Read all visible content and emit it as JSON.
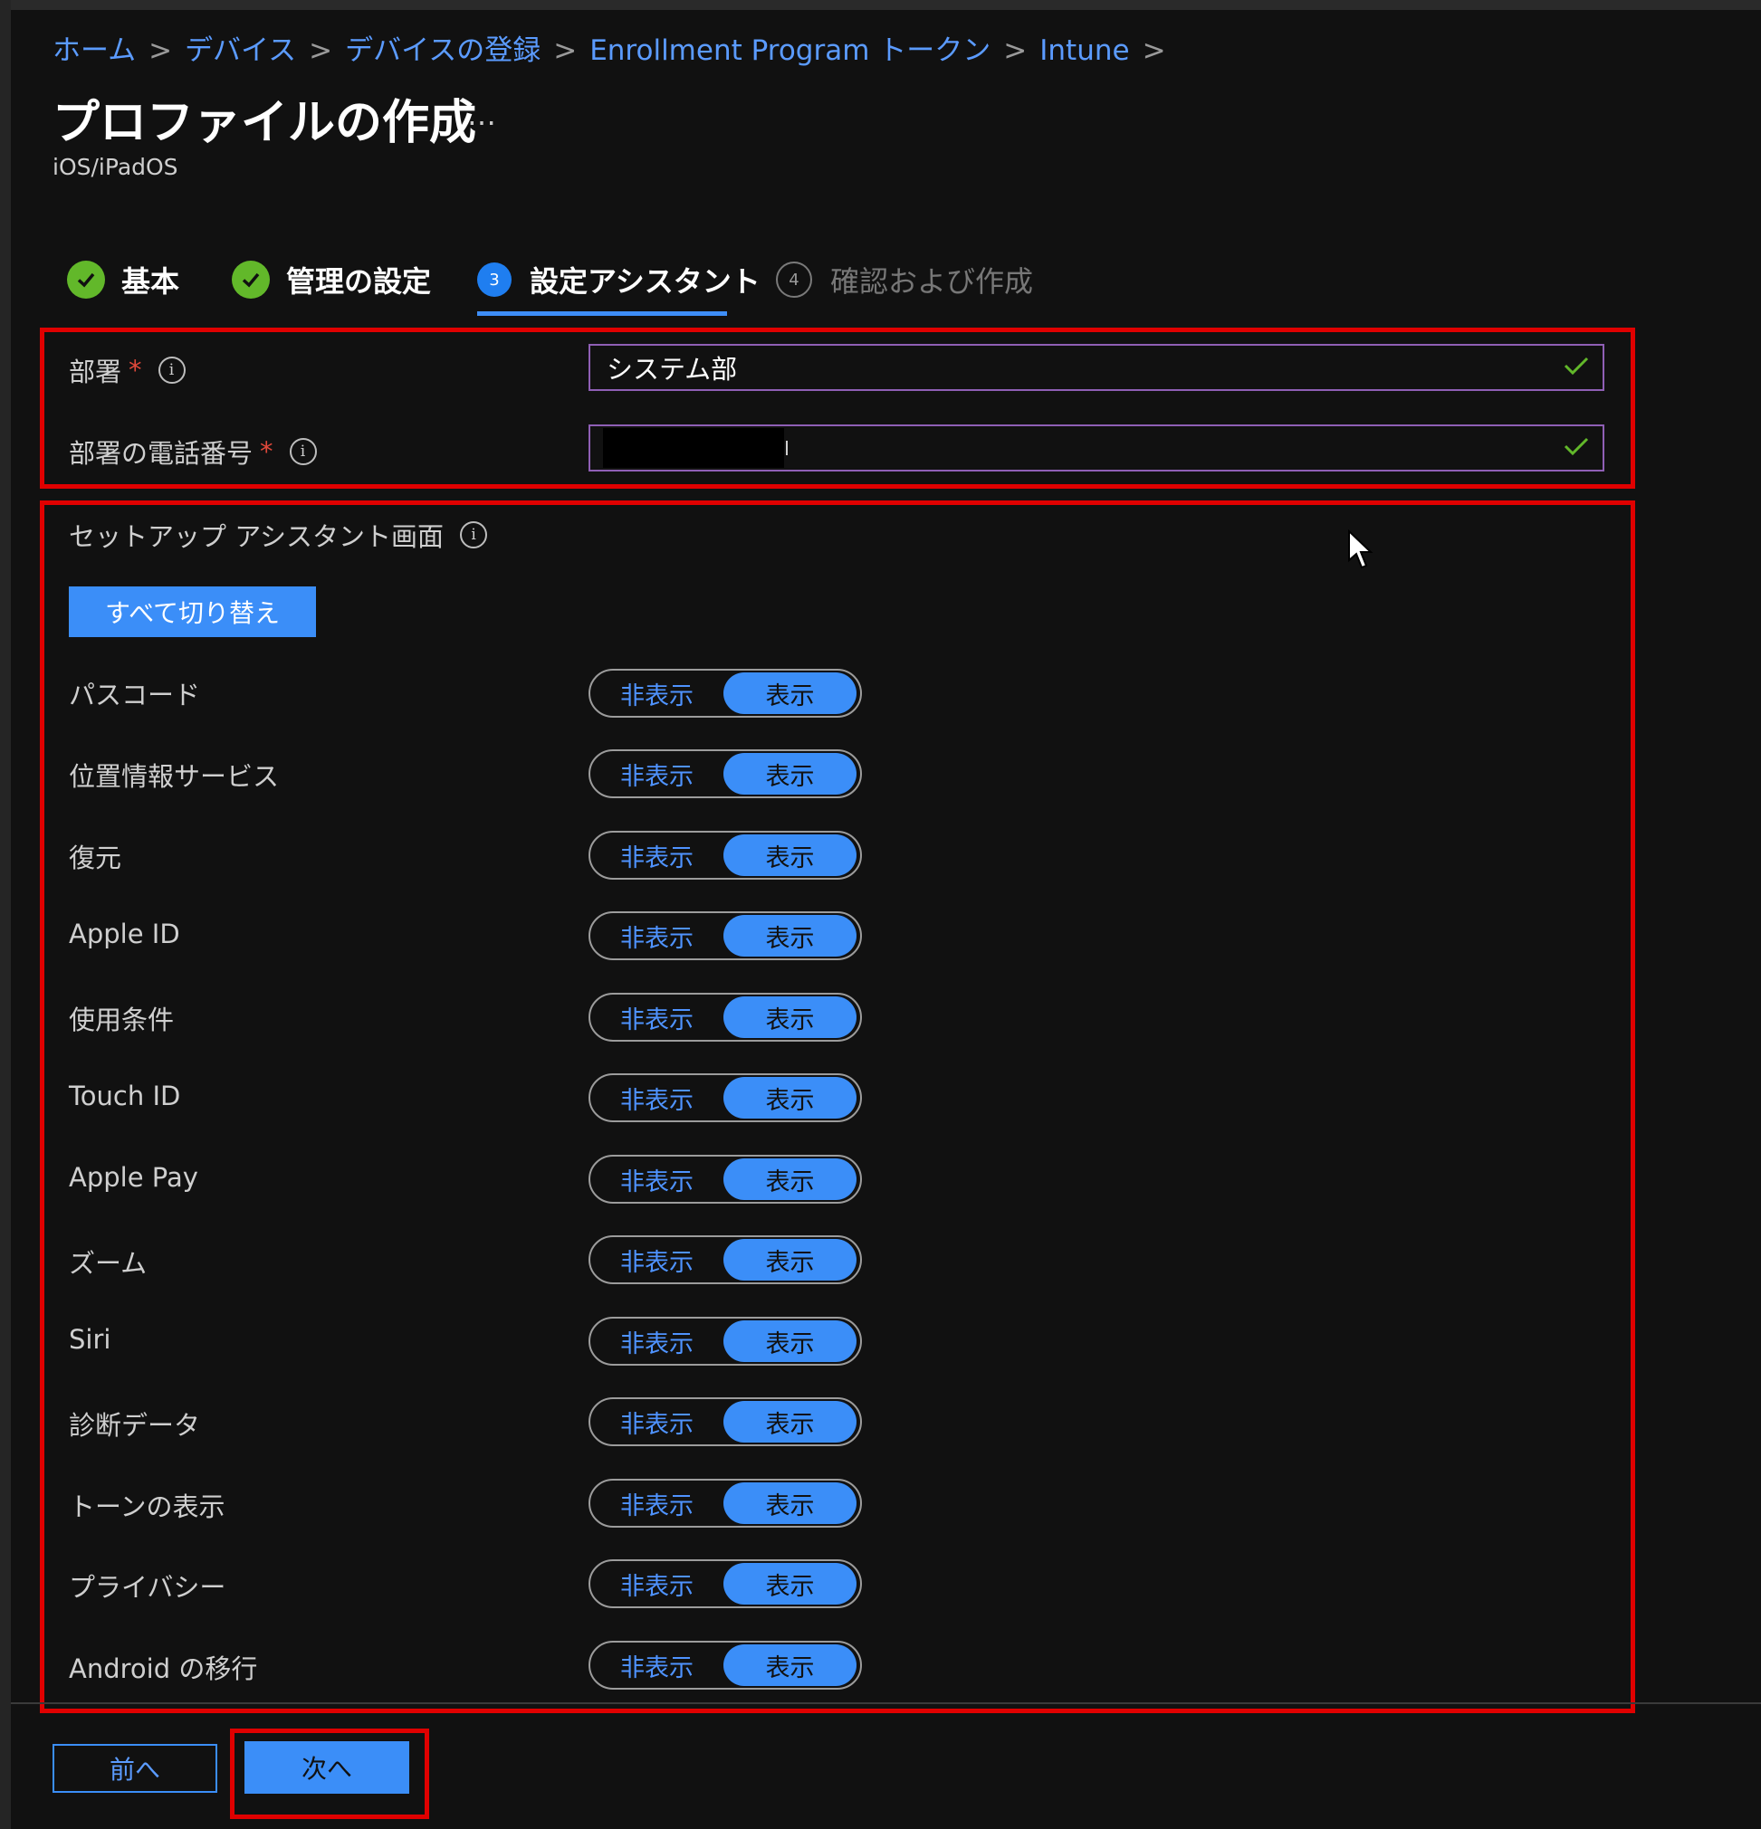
{
  "breadcrumb": [
    "ホーム",
    "デバイス",
    "デバイスの登録",
    "Enrollment Program トークン",
    "Intune"
  ],
  "page": {
    "title": "プロファイルの作成",
    "more": "…",
    "subtitle": "iOS/iPadOS"
  },
  "steps": [
    {
      "label": "基本",
      "state": "done"
    },
    {
      "label": "管理の設定",
      "state": "done"
    },
    {
      "number": "3",
      "label": "設定アシスタント",
      "state": "active"
    },
    {
      "number": "4",
      "label": "確認および作成",
      "state": "pending"
    }
  ],
  "form": {
    "department": {
      "label": "部署",
      "value": "システム部"
    },
    "department_phone": {
      "label": "部署の電話番号",
      "value": ""
    },
    "required_mark": "*",
    "info_glyph": "i"
  },
  "setup": {
    "section_label": "セットアップ アシスタント画面",
    "toggle_all": "すべて切り替え",
    "hide_label": "非表示",
    "show_label": "表示",
    "items": [
      {
        "label": "パスコード",
        "selected": "表示"
      },
      {
        "label": "位置情報サービス",
        "selected": "表示"
      },
      {
        "label": "復元",
        "selected": "表示"
      },
      {
        "label": "Apple ID",
        "selected": "表示"
      },
      {
        "label": "使用条件",
        "selected": "表示"
      },
      {
        "label": "Touch ID",
        "selected": "表示"
      },
      {
        "label": "Apple Pay",
        "selected": "表示"
      },
      {
        "label": "ズーム",
        "selected": "表示"
      },
      {
        "label": "Siri",
        "selected": "表示"
      },
      {
        "label": "診断データ",
        "selected": "表示"
      },
      {
        "label": "トーンの表示",
        "selected": "表示"
      },
      {
        "label": "プライバシー",
        "selected": "表示"
      },
      {
        "label": "Android の移行",
        "selected": "表示"
      }
    ]
  },
  "footer": {
    "prev": "前へ",
    "next": "次へ"
  },
  "colors": {
    "accent": "#3b8ef8",
    "link": "#5b9bff",
    "success": "#62b82a",
    "highlight": "#e00000",
    "background": "#111111"
  }
}
